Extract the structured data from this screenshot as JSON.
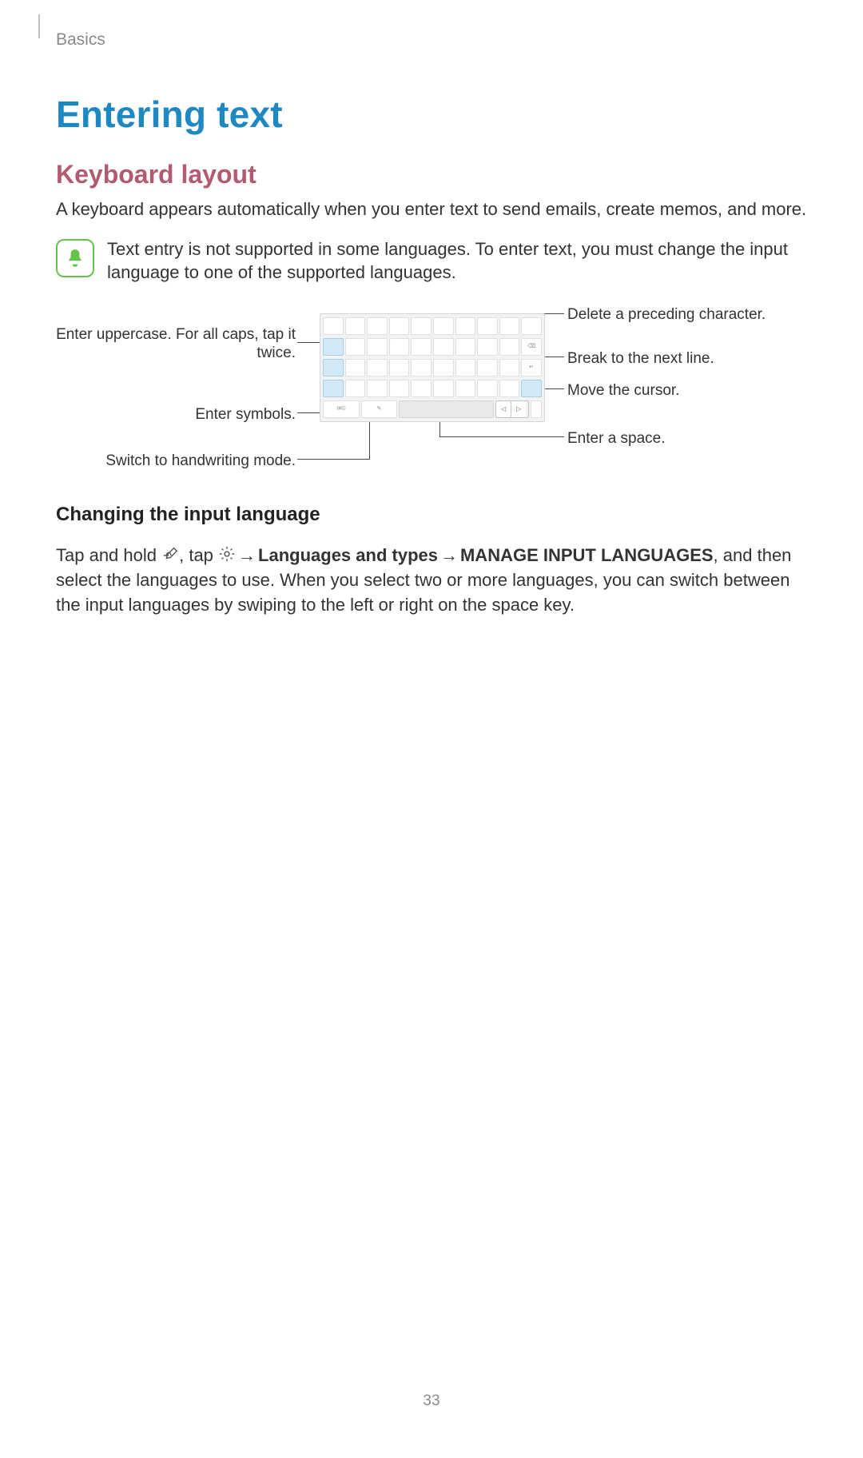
{
  "header": {
    "crumb": "Basics"
  },
  "title": "Entering text",
  "section1": {
    "heading": "Keyboard layout",
    "body": "A keyboard appears automatically when you enter text to send emails, create memos, and more.",
    "note": "Text entry is not supported in some languages. To enter text, you must change the input language to one of the supported languages."
  },
  "callouts": {
    "left": {
      "uppercase": "Enter uppercase. For all caps, tap it twice.",
      "symbols": "Enter symbols.",
      "handwriting": "Switch to handwriting mode."
    },
    "right": {
      "delete": "Delete a preceding character.",
      "break": "Break to the next line.",
      "cursor": "Move the cursor.",
      "space": "Enter a space."
    }
  },
  "section2": {
    "heading": "Changing the input language",
    "instr_prefix": "Tap and hold ",
    "instr_mid1": ", tap ",
    "arrow": " → ",
    "bold1": "Languages and types",
    "bold2": "MANAGE INPUT LANGUAGES",
    "instr_suffix": ", and then select the languages to use. When you select two or more languages, you can switch between the input languages by swiping to the left or right on the space key."
  },
  "page_number": "33"
}
